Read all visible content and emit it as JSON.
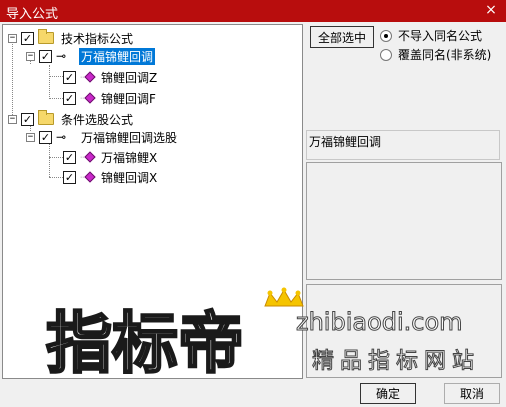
{
  "window": {
    "title": "导入公式",
    "close_label": "×"
  },
  "tree": {
    "group1": {
      "label": "技术指标公式",
      "expander": "−",
      "checked": "✓"
    },
    "formula1": {
      "label": "万福锦鲤回调",
      "expander": "−",
      "checked": "✓"
    },
    "formula1_children": [
      {
        "label": "锦鲤回调Z",
        "checked": "✓"
      },
      {
        "label": "锦鲤回调F",
        "checked": "✓"
      }
    ],
    "group2": {
      "label": "条件选股公式",
      "expander": "−",
      "checked": "✓"
    },
    "formula2": {
      "label": "万福锦鲤回调选股",
      "expander": "−",
      "checked": "✓"
    },
    "formula2_children": [
      {
        "label": "万福锦鲤X",
        "checked": "✓"
      },
      {
        "label": "锦鲤回调X",
        "checked": "✓"
      }
    ]
  },
  "options": {
    "select_all_label": "全部选中",
    "radio_skip_label": "不导入同名公式",
    "radio_overwrite_label": "覆盖同名(非系统)"
  },
  "preview": {
    "name": "万福锦鲤回调"
  },
  "footer": {
    "ok_label": "确定",
    "cancel_label": "取消"
  },
  "watermark": {
    "logo_text": "指标帝",
    "domain": "zhibiaodi.com",
    "tagline": "精品指标网站"
  },
  "colors": {
    "titlebar": "#b80d0d",
    "selection": "#0078d7",
    "leaf_icon": "#c928c9"
  }
}
